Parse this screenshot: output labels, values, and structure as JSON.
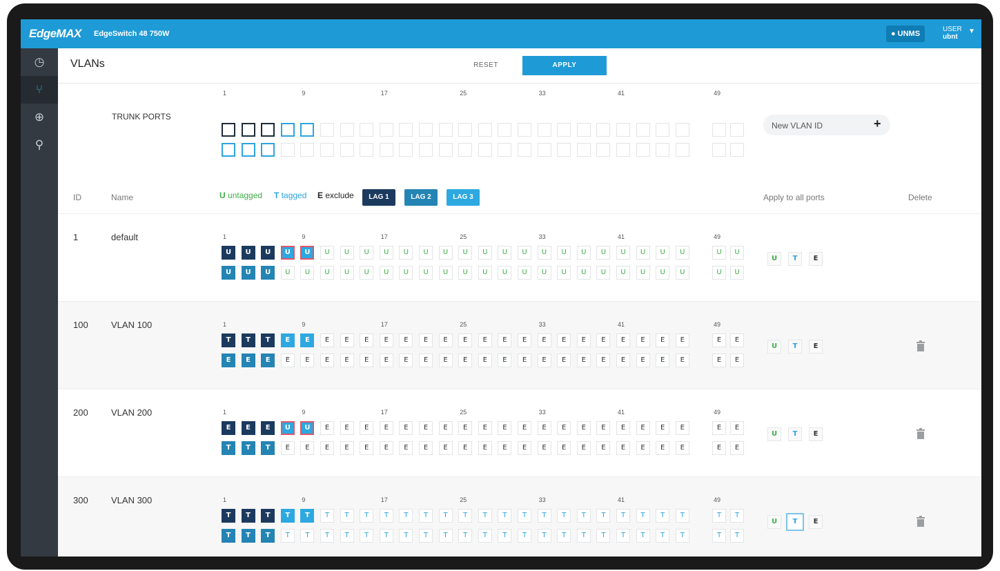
{
  "app": {
    "logo": "EdgeMAX",
    "model": "EdgeSwitch 48 750W",
    "unms_label": "● UNMS",
    "user_label": "USER",
    "user_name": "ubnt"
  },
  "sidebar": {
    "items": [
      {
        "name": "dashboard",
        "icon": "dashboard-icon",
        "glyph": "◷"
      },
      {
        "name": "vlans",
        "icon": "vlan-icon",
        "glyph": "⑂",
        "active": true
      },
      {
        "name": "routing",
        "icon": "globe-icon",
        "glyph": "⊕"
      },
      {
        "name": "tools",
        "icon": "wrench-icon",
        "glyph": "⚲"
      }
    ]
  },
  "page": {
    "title": "VLANs",
    "reset_label": "RESET",
    "apply_label": "APPLY"
  },
  "trunk": {
    "label": "TRUNK PORTS",
    "states": "OOOTT-----------------------OOO-----------------------------"
  },
  "port_numbers": [
    "1",
    "9",
    "17",
    "25",
    "33",
    "41",
    "49"
  ],
  "new_vlan": {
    "placeholder": "New VLAN ID",
    "add_icon": "+"
  },
  "headers": {
    "id": "ID",
    "name": "Name",
    "apply_all": "Apply to all ports",
    "delete": "Delete"
  },
  "legend": {
    "untagged_key": "U",
    "untagged_text": "untagged",
    "tagged_key": "T",
    "tagged_text": "tagged",
    "exclude_key": "E",
    "exclude_text": "exclude",
    "lags": [
      {
        "label": "LAG 1",
        "color": "#1b3a5e"
      },
      {
        "label": "LAG 2",
        "color": "#2484b4"
      },
      {
        "label": "LAG 3",
        "color": "#2da8e0"
      }
    ]
  },
  "apply_all_options": [
    "U",
    "T",
    "E"
  ],
  "vlans": [
    {
      "id": "1",
      "name": "default",
      "top": "111ss",
      "top_rest": "uuuuuuuuuuuuuuuuuuuuuuu",
      "bottom": "222",
      "bottom_rest": "uuuuuuuuuuuuuuuuuuuuuuuuu",
      "top_letters": "UUUUUUUUUUUUUUUUUUUUUUUUUUU",
      "bottom_letters": "UUUUUUUUUUUUUUUUUUUUUUUUUUU",
      "deletable": false,
      "selected_all": ""
    },
    {
      "id": "100",
      "name": "VLAN 100",
      "top_letters": "TTTEEEEEEEEEEEEEEEEEEEEEEEE",
      "bottom_letters": "EEEEEEEEEEEEEEEEEEEEEEEEEEE",
      "deletable": true,
      "selected_all": ""
    },
    {
      "id": "200",
      "name": "VLAN 200",
      "top_letters": "EEEUUEEEEEEEEEEEEEEEEEEEEEE",
      "bottom_letters": "TTTEEEEEEEEEEEEEEEEEEEEEEEE",
      "deletable": true,
      "selected_all": ""
    },
    {
      "id": "300",
      "name": "VLAN 300",
      "top_letters": "TTTTTTTTTTTTTTTTTTTTTTTTTTT",
      "bottom_letters": "TTTTTTTTTTTTTTTTTTTTTTTTTTT",
      "deletable": true,
      "selected_all": "T"
    }
  ],
  "colors": {
    "primary": "#1e9ad6",
    "untagged": "#3fae49",
    "tagged": "#2ea3e0",
    "exclude": "#333333",
    "lag1": "#1b3a5e",
    "lag2": "#2484b4",
    "lag3": "#2da8e0",
    "highlight": "#e0556b"
  }
}
